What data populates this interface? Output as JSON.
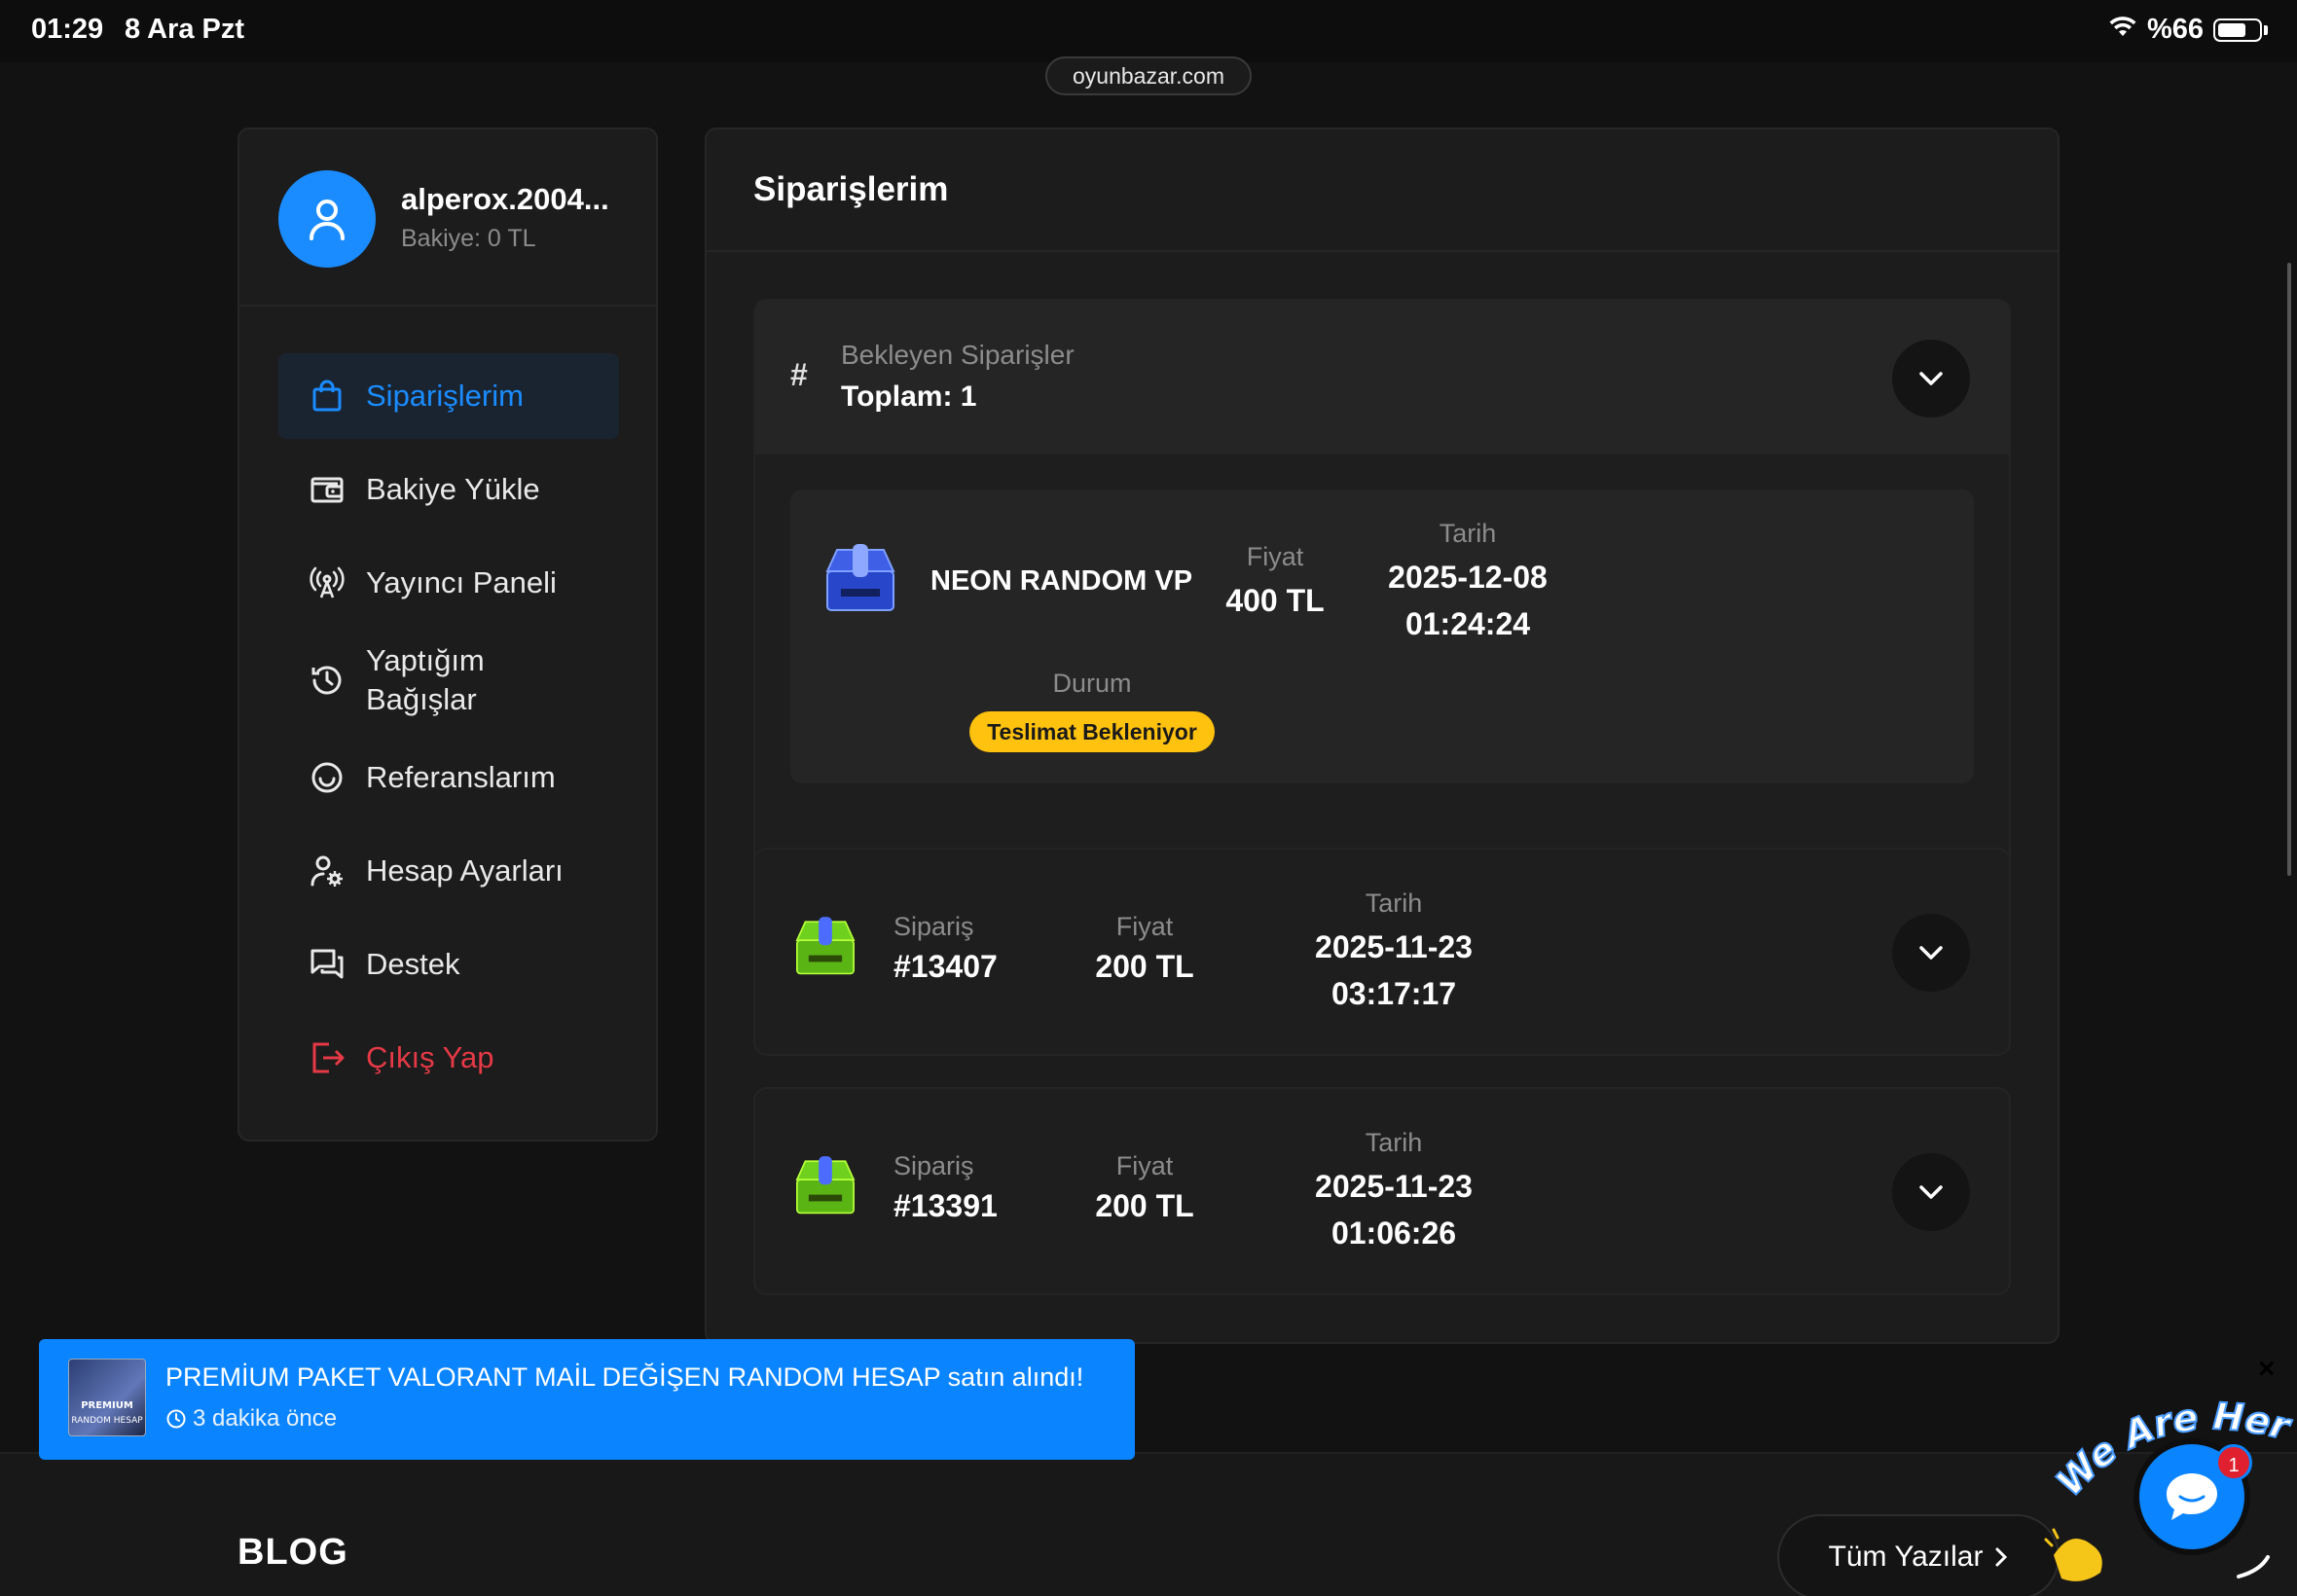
{
  "status_bar": {
    "time": "01:29",
    "date": "8 Ara Pzt",
    "battery": "%66"
  },
  "browser": {
    "url": "oyunbazar.com"
  },
  "profile": {
    "username": "alperox.2004...",
    "balance": "Bakiye: 0 TL"
  },
  "menu": [
    {
      "label": "Siparişlerim",
      "icon": "shopping-bag-icon",
      "active": true
    },
    {
      "label": "Bakiye Yükle",
      "icon": "wallet-icon"
    },
    {
      "label": "Yayıncı Paneli",
      "icon": "broadcast-icon"
    },
    {
      "label": "Yaptığım Bağışlar",
      "icon": "history-icon"
    },
    {
      "label": "Referanslarım",
      "icon": "smile-icon"
    },
    {
      "label": "Hesap Ayarları",
      "icon": "user-gear-icon"
    },
    {
      "label": "Destek",
      "icon": "chat-icon"
    },
    {
      "label": "Çıkış Yap",
      "icon": "logout-icon",
      "danger": true
    }
  ],
  "orders_page": {
    "title": "Siparişlerim",
    "pending": {
      "hash": "#",
      "label": "Bekleyen Siparişler",
      "total": "Toplam: 1",
      "item": {
        "name": "NEON RANDOM VP",
        "price_label": "Fiyat",
        "price": "400 TL",
        "date_label": "Tarih",
        "date": "2025-12-08",
        "time": "01:24:24",
        "status_label": "Durum",
        "status": "Teslimat Bekleniyor"
      }
    },
    "orders": [
      {
        "label": "Sipariş",
        "number": "#13407",
        "price_label": "Fiyat",
        "price": "200 TL",
        "date_label": "Tarih",
        "date": "2025-11-23",
        "time": "03:17:17"
      },
      {
        "label": "Sipariş",
        "number": "#13391",
        "price_label": "Fiyat",
        "price": "200 TL",
        "date_label": "Tarih",
        "date": "2025-11-23",
        "time": "01:06:26"
      }
    ]
  },
  "toast": {
    "message": "PREMİUM PAKET VALORANT MAİL DEĞİŞEN RANDOM HESAP satın alındı!",
    "time": "3 dakika önce",
    "thumb_text_1": "PREMIUM",
    "thumb_text_2": "RANDOM HESAP"
  },
  "blog": {
    "title": "BLOG",
    "all_label": "Tüm Yazılar"
  },
  "chat": {
    "banner": "We Are Here!",
    "unread": "1",
    "close": "×"
  },
  "colors": {
    "accent": "#1a8cff",
    "danger": "#e53946",
    "badge": "#ffc20e",
    "toast": "#0a84ff"
  }
}
